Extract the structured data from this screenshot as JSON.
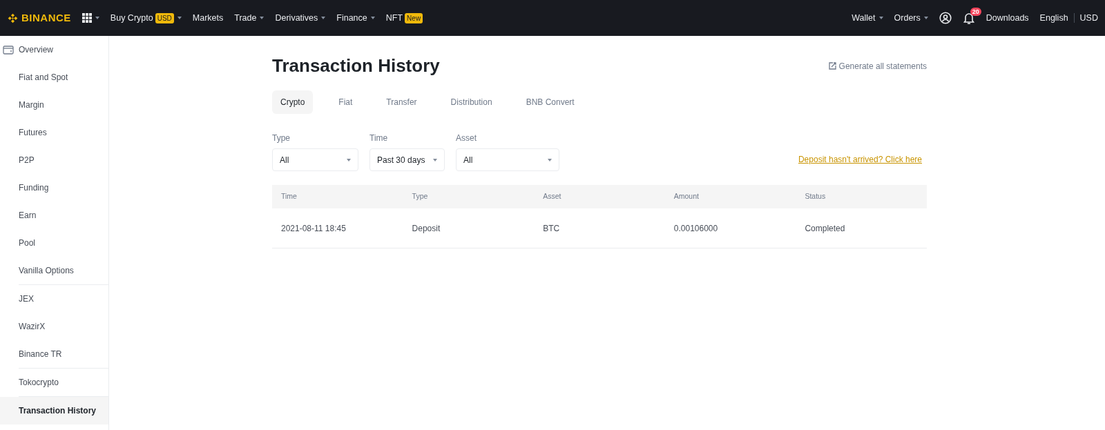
{
  "navbar": {
    "logo": "BINANCE",
    "menu": [
      {
        "label": "Buy Crypto",
        "badge": "USD",
        "dropdown": true
      },
      {
        "label": "Markets",
        "dropdown": false
      },
      {
        "label": "Trade",
        "dropdown": true
      },
      {
        "label": "Derivatives",
        "dropdown": true
      },
      {
        "label": "Finance",
        "dropdown": true
      },
      {
        "label": "NFT",
        "badge": "New",
        "dropdown": false
      }
    ],
    "right": [
      {
        "label": "Wallet",
        "dropdown": true
      },
      {
        "label": "Orders",
        "dropdown": true
      }
    ],
    "notification_count": "20",
    "downloads": "Downloads",
    "language": "English",
    "currency": "USD"
  },
  "sidebar": {
    "groups": [
      [
        {
          "label": "Overview",
          "icon": true,
          "selected": false
        },
        {
          "label": "Fiat and Spot",
          "selected": false
        },
        {
          "label": "Margin",
          "selected": false
        },
        {
          "label": "Futures",
          "selected": false
        },
        {
          "label": "P2P",
          "selected": false
        },
        {
          "label": "Funding",
          "selected": false
        },
        {
          "label": "Earn",
          "selected": false
        },
        {
          "label": "Pool",
          "selected": false
        },
        {
          "label": "Vanilla Options",
          "selected": false
        }
      ],
      [
        {
          "label": "JEX",
          "selected": false
        },
        {
          "label": "WazirX",
          "selected": false
        },
        {
          "label": "Binance TR",
          "selected": false
        }
      ],
      [
        {
          "label": "Tokocrypto",
          "selected": false
        }
      ],
      [
        {
          "label": "Transaction History",
          "selected": true
        }
      ]
    ]
  },
  "page": {
    "title": "Transaction History",
    "generate_link": "Generate all statements",
    "tabs": [
      {
        "label": "Crypto",
        "selected": true
      },
      {
        "label": "Fiat",
        "selected": false
      },
      {
        "label": "Transfer",
        "selected": false
      },
      {
        "label": "Distribution",
        "selected": false
      },
      {
        "label": "BNB Convert",
        "selected": false
      }
    ],
    "filters": [
      {
        "label": "Type",
        "value": "All"
      },
      {
        "label": "Time",
        "value": "Past 30 days"
      },
      {
        "label": "Asset",
        "value": "All"
      }
    ],
    "deposit_link": "Deposit hasn't arrived? Click here",
    "table": {
      "columns": [
        "Time",
        "Type",
        "Asset",
        "Amount",
        "Status"
      ],
      "rows": [
        [
          "2021-08-11 18:45",
          "Deposit",
          "BTC",
          "0.00106000",
          "Completed"
        ]
      ]
    }
  }
}
